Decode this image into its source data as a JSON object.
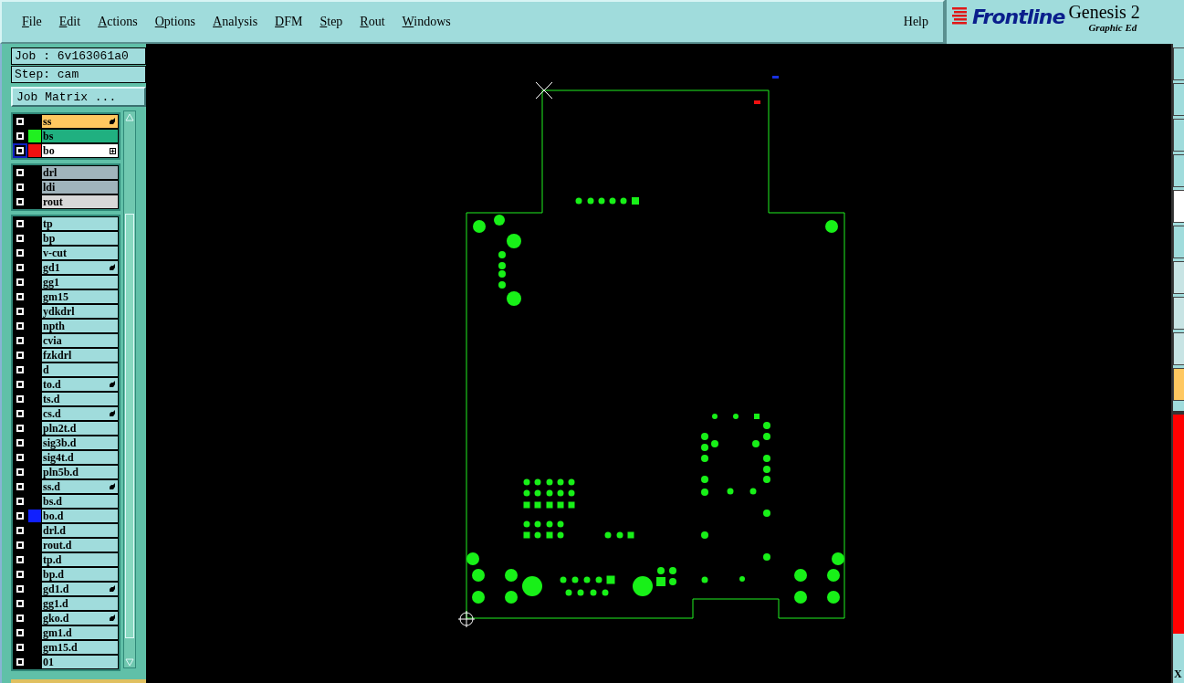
{
  "menu": [
    "File",
    "Edit",
    "Actions",
    "Options",
    "Analysis",
    "DFM",
    "Step",
    "Rout",
    "Windows"
  ],
  "help": "Help",
  "logo": {
    "brand": "Frontline",
    "product": "Genesis 2",
    "subtitle": "Graphic Ed"
  },
  "job": {
    "job_label": "Job : 6v163061a0",
    "step_label": "Step: cam",
    "matrix_button": "Job Matrix ..."
  },
  "layer_groups": [
    {
      "layers": [
        {
          "name": "ss",
          "color": "#ffc860",
          "marked": true,
          "selected": false
        },
        {
          "name": "bs",
          "color": "#20b080",
          "swatch": {
            "color": "#20f020"
          },
          "marked": false,
          "selected": false
        },
        {
          "name": "bo",
          "color": "#ffffff",
          "swatch": {
            "color": "#f01010"
          },
          "marked": false,
          "selected": true,
          "expand": true
        }
      ]
    },
    {
      "layers": [
        {
          "name": "drl",
          "color": "#a0b4bc",
          "marked": false,
          "selected": false
        },
        {
          "name": "ldi",
          "color": "#a0b4bc",
          "marked": false,
          "selected": false
        },
        {
          "name": "rout",
          "color": "#d8d8d8",
          "marked": false,
          "selected": false
        }
      ]
    },
    {
      "layers": [
        {
          "name": "tp",
          "color": "#a0dcdc",
          "marked": false,
          "selected": false
        },
        {
          "name": "bp",
          "color": "#a0dcdc",
          "marked": false,
          "selected": false
        },
        {
          "name": "v-cut",
          "color": "#a0dcdc",
          "marked": false,
          "selected": false
        },
        {
          "name": "gd1",
          "color": "#a0dcdc",
          "marked": true,
          "selected": false
        },
        {
          "name": "gg1",
          "color": "#a0dcdc",
          "marked": false,
          "selected": false
        },
        {
          "name": "gm15",
          "color": "#a0dcdc",
          "marked": false,
          "selected": false
        },
        {
          "name": "ydkdrl",
          "color": "#a0dcdc",
          "marked": false,
          "selected": false
        },
        {
          "name": "npth",
          "color": "#a0dcdc",
          "marked": false,
          "selected": false
        },
        {
          "name": "cvia",
          "color": "#a0dcdc",
          "marked": false,
          "selected": false
        },
        {
          "name": "fzkdrl",
          "color": "#a0dcdc",
          "marked": false,
          "selected": false
        },
        {
          "name": "d",
          "color": "#a0dcdc",
          "marked": false,
          "selected": false
        },
        {
          "name": "to.d",
          "color": "#a0dcdc",
          "marked": true,
          "selected": false
        },
        {
          "name": "ts.d",
          "color": "#a0dcdc",
          "marked": false,
          "selected": false
        },
        {
          "name": "cs.d",
          "color": "#a0dcdc",
          "marked": true,
          "selected": false
        },
        {
          "name": "pln2t.d",
          "color": "#a0dcdc",
          "marked": false,
          "selected": false
        },
        {
          "name": "sig3b.d",
          "color": "#a0dcdc",
          "marked": false,
          "selected": false
        },
        {
          "name": "sig4t.d",
          "color": "#a0dcdc",
          "marked": false,
          "selected": false
        },
        {
          "name": "pln5b.d",
          "color": "#a0dcdc",
          "marked": false,
          "selected": false
        },
        {
          "name": "ss.d",
          "color": "#a0dcdc",
          "marked": true,
          "selected": false
        },
        {
          "name": "bs.d",
          "color": "#a0dcdc",
          "marked": false,
          "selected": false
        },
        {
          "name": "bo.d",
          "color": "#a0dcdc",
          "swatch": {
            "color": "#1020ff"
          },
          "marked": false,
          "selected": false
        },
        {
          "name": "drl.d",
          "color": "#a0dcdc",
          "marked": false,
          "selected": false
        },
        {
          "name": "rout.d",
          "color": "#a0dcdc",
          "marked": false,
          "selected": false
        },
        {
          "name": "tp.d",
          "color": "#a0dcdc",
          "marked": false,
          "selected": false
        },
        {
          "name": "bp.d",
          "color": "#a0dcdc",
          "marked": false,
          "selected": false
        },
        {
          "name": "gd1.d",
          "color": "#a0dcdc",
          "marked": true,
          "selected": false
        },
        {
          "name": "gg1.d",
          "color": "#a0dcdc",
          "marked": false,
          "selected": false
        },
        {
          "name": "gko.d",
          "color": "#a0dcdc",
          "marked": true,
          "selected": false
        },
        {
          "name": "gm1.d",
          "color": "#a0dcdc",
          "marked": false,
          "selected": false
        },
        {
          "name": "gm15.d",
          "color": "#a0dcdc",
          "marked": false,
          "selected": false
        },
        {
          "name": "01",
          "color": "#a0dcdc",
          "marked": false,
          "selected": false
        }
      ]
    }
  ],
  "right_toolbar": {
    "coordinate_label": "X"
  }
}
